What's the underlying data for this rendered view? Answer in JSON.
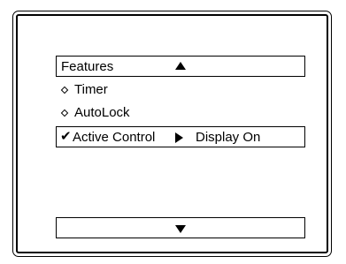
{
  "menu": {
    "title": "Features",
    "scroll_up_icon": "triangle-up-icon",
    "scroll_down_icon": "triangle-down-icon",
    "items": [
      {
        "label": "Timer",
        "icon": "diamond-bullet-icon"
      },
      {
        "label": "AutoLock",
        "icon": "diamond-bullet-icon"
      }
    ],
    "selected_item": {
      "check": "✔",
      "label": "Active Control",
      "submenu_icon": "triangle-right-icon",
      "value": "Display On"
    }
  },
  "colors": {
    "foreground": "#000000",
    "background": "#ffffff"
  }
}
